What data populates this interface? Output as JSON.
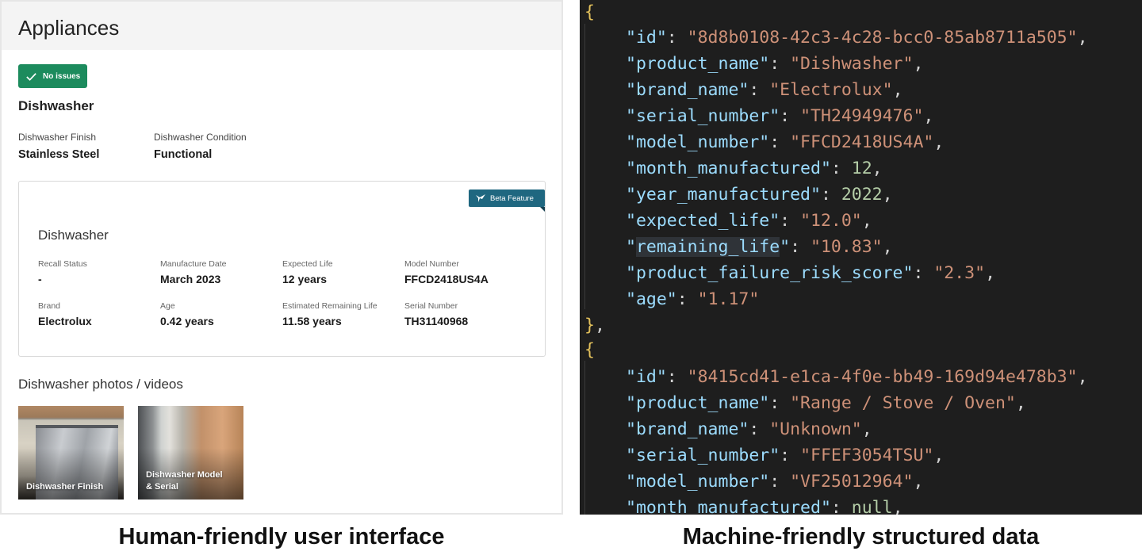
{
  "ui": {
    "page_title": "Appliances",
    "status_badge": "No issues",
    "item_title": "Dishwasher",
    "fields": [
      {
        "label": "Dishwasher Finish",
        "value": "Stainless Steel"
      },
      {
        "label": "Dishwasher Condition",
        "value": "Functional"
      }
    ],
    "card": {
      "beta_label": "Beta Feature",
      "title": "Dishwasher",
      "cells": [
        {
          "label": "Recall Status",
          "value": "-"
        },
        {
          "label": "Manufacture Date",
          "value": "March 2023"
        },
        {
          "label": "Expected Life",
          "value": "12 years"
        },
        {
          "label": "Model Number",
          "value": "FFCD2418US4A"
        },
        {
          "label": "Brand",
          "value": "Electrolux"
        },
        {
          "label": "Age",
          "value": "0.42 years"
        },
        {
          "label": "Estimated Remaining Life",
          "value": "11.58 years"
        },
        {
          "label": "Serial Number",
          "value": "TH31140968"
        }
      ]
    },
    "photos_heading": "Dishwasher photos / videos",
    "photos": [
      {
        "caption_line1": "Dishwasher Finish",
        "caption_line2": ""
      },
      {
        "caption_line1": "Dishwasher Model",
        "caption_line2": "& Serial"
      }
    ]
  },
  "code": {
    "records": [
      {
        "id": "\"8d8b0108-42c3-4c28-bcc0-85ab8711a505\"",
        "product_name": "\"Dishwasher\"",
        "brand_name": "\"Electrolux\"",
        "serial_number": "\"TH24949476\"",
        "model_number": "\"FFCD2418US4A\"",
        "month_manufactured": "12",
        "year_manufactured": "2022",
        "expected_life": "\"12.0\"",
        "remaining_life": "\"10.83\"",
        "product_failure_risk_score": "\"2.3\"",
        "age": "\"1.17\""
      },
      {
        "id": "\"8415cd41-e1ca-4f0e-bb49-169d94e478b3\"",
        "product_name": "\"Range / Stove / Oven\"",
        "brand_name": "\"Unknown\"",
        "serial_number": "\"FFEF3054TSU\"",
        "model_number": "\"VF25012964\"",
        "month_manufactured": "null"
      }
    ]
  },
  "captions": {
    "left": "Human-friendly user interface",
    "right": "Machine-friendly structured data"
  },
  "colors": {
    "badge_green": "#1c8b5d",
    "beta_teal": "#1f6780",
    "editor_bg": "#1e1e1e",
    "json_key": "#9cdcfe",
    "json_string": "#ce9178",
    "json_number": "#b5cea8"
  }
}
